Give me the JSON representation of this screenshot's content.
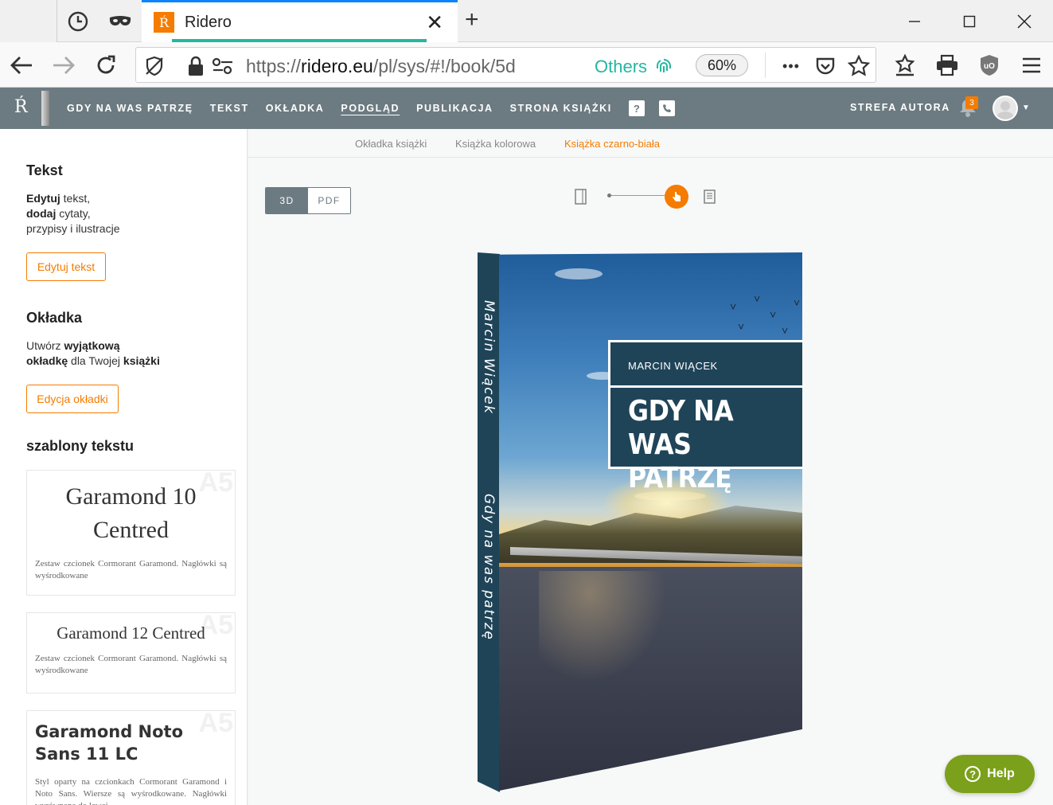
{
  "browser": {
    "tab_title": "Ridero",
    "tab_favicon": "Ŕ",
    "tab_close": "✕",
    "new_tab": "+",
    "url_prefix": "https://",
    "url_domain": "ridero.eu",
    "url_rest": "/pl/sys/#!/book/5d",
    "container_label": "Others",
    "zoom": "60%",
    "more": "•••",
    "accent": "#0a84ff"
  },
  "site": {
    "logo": "Ŕ",
    "nav": [
      "GDY NA WAS PATRZĘ",
      "TEKST",
      "OKŁADKA",
      "PODGLĄD",
      "PUBLIKACJA",
      "STRONA KSIĄŻKI"
    ],
    "nav_active_index": 3,
    "help_square": "?",
    "author_zone": "STREFA AUTORA",
    "notifications": "3",
    "header_color": "#6c7b81",
    "accent": "#f57c00"
  },
  "sidebar": {
    "text_heading": "Tekst",
    "text_desc_1_bold": "Edytuj",
    "text_desc_1": " tekst,",
    "text_desc_2_bold": "dodaj",
    "text_desc_2": " cytaty,",
    "text_desc_3": "przypisy i ilustracje",
    "edit_text_btn": "Edytuj tekst",
    "cover_heading": "Okładka",
    "cover_desc_1": "Utwórz ",
    "cover_desc_1_bold": "wyjątkową",
    "cover_desc_2_bold": "okładkę",
    "cover_desc_2": " dla Twojej ",
    "cover_desc_2_bold2": "książki",
    "edit_cover_btn": "Edycja okładki",
    "templates_heading": "szablony tekstu",
    "templates": [
      {
        "size": "A5",
        "title": "Garamond 10 Centred",
        "desc": "Zestaw czcionek Cormorant Garamond. Nagłówki są wyśrodkowane"
      },
      {
        "size": "A5",
        "title": "Garamond 12 Centred",
        "desc": "Zestaw czcionek Cormorant Garamond. Nagłówki są wyśrodkowane"
      },
      {
        "size": "A5",
        "title": "Garamond Noto Sans 11 LC",
        "desc": "Styl oparty na czcionkach Cormorant Garamond i Noto Sans. Wiersze są wyśrodkowane. Nagłówki wyrównane do lewej"
      }
    ]
  },
  "main": {
    "subtabs": [
      "Okładka książki",
      "Książka kolorowa",
      "Książka czarno-biała"
    ],
    "subtab_active_index": 2,
    "view_3d": "3D",
    "view_pdf": "PDF",
    "slider_level": 0.8,
    "book": {
      "author": "MARCIN WIĄCEK",
      "title": "GDY NA WAS PATRZĘ",
      "spine_author": "Marcin Wiącek",
      "spine_title": "Gdy na was patrzę"
    },
    "help": "Help",
    "help_color": "#7ba01b"
  }
}
